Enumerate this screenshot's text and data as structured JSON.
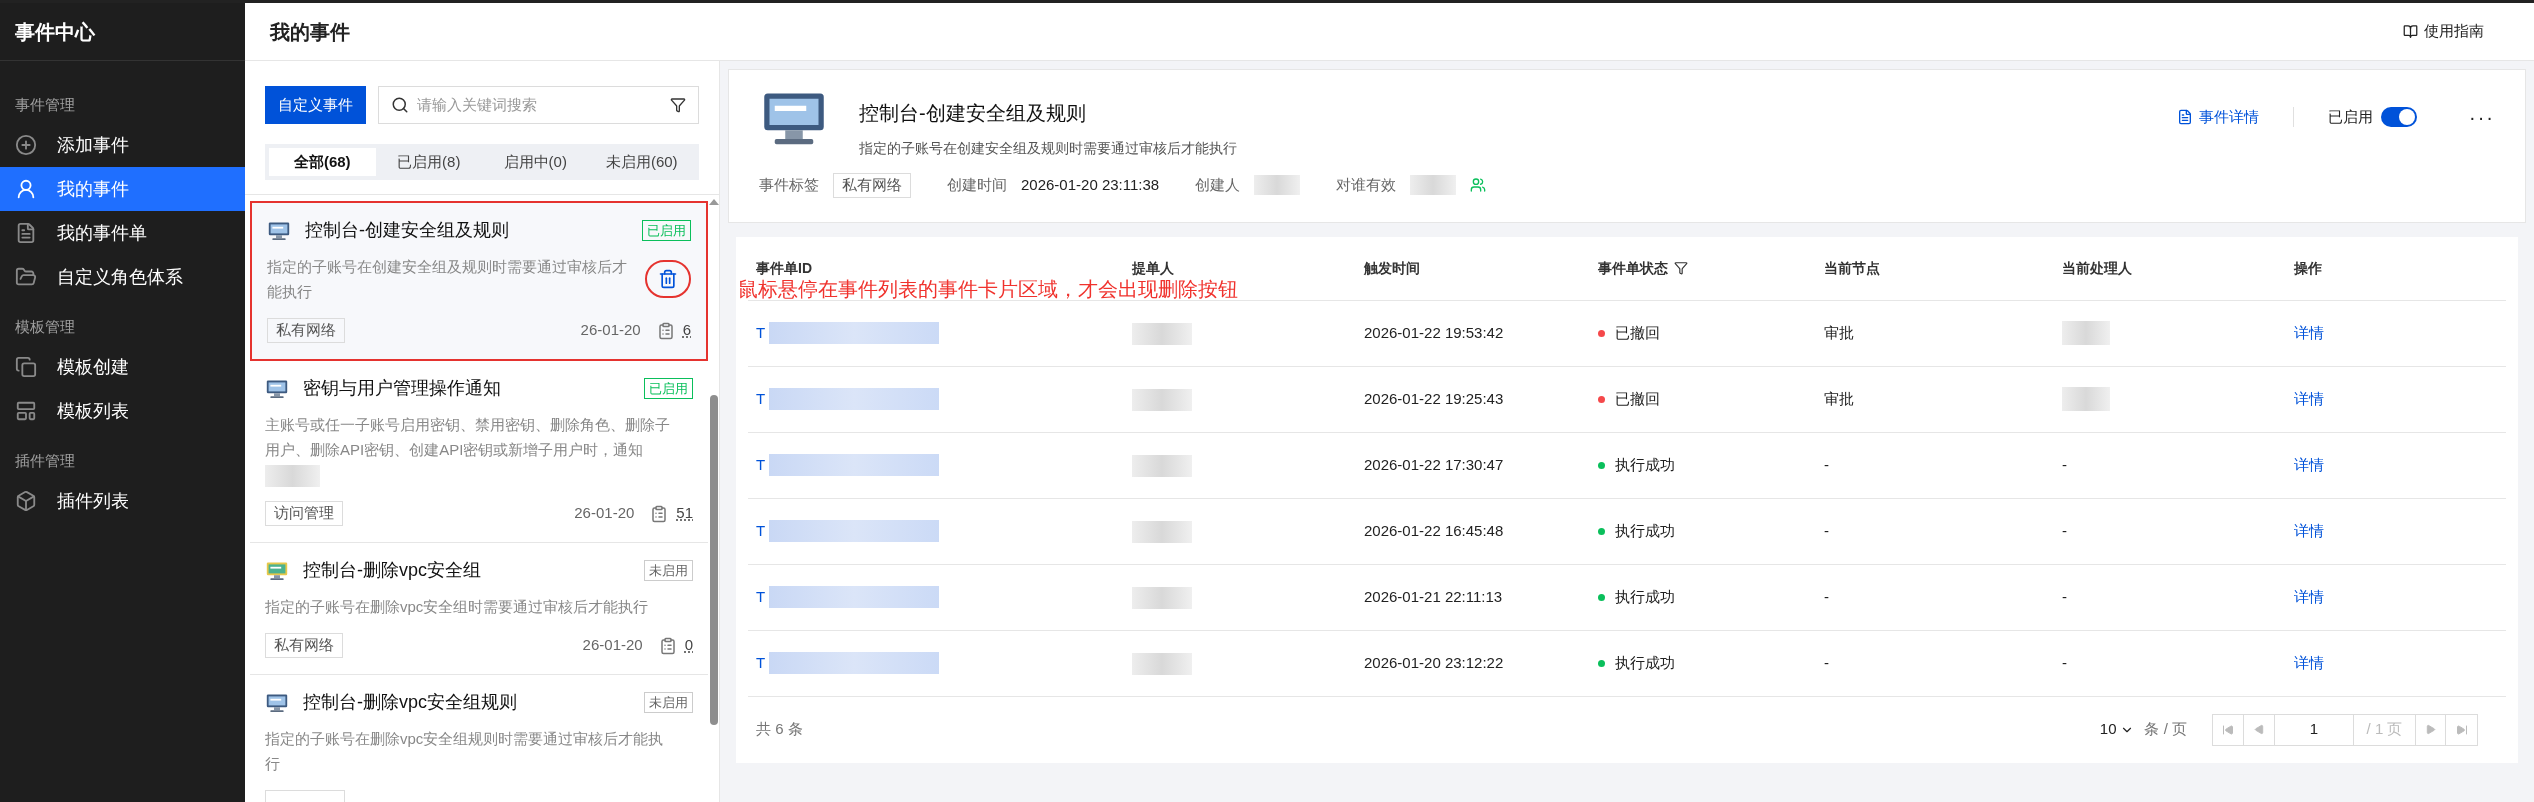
{
  "sidebar": {
    "title": "事件中心",
    "sections": [
      {
        "heading": "事件管理",
        "items": [
          {
            "label": "添加事件",
            "selected": false
          },
          {
            "label": "我的事件",
            "selected": true
          },
          {
            "label": "我的事件单",
            "selected": false
          },
          {
            "label": "自定义角色体系",
            "selected": false
          }
        ]
      },
      {
        "heading": "模板管理",
        "items": [
          {
            "label": "模板创建",
            "selected": false
          },
          {
            "label": "模板列表",
            "selected": false
          }
        ]
      },
      {
        "heading": "插件管理",
        "items": [
          {
            "label": "插件列表",
            "selected": false
          }
        ]
      }
    ]
  },
  "header": {
    "title": "我的事件",
    "guide_link": "使用指南"
  },
  "event_list": {
    "create_button": "自定义事件",
    "search": {
      "placeholder": "请输入关键词搜索"
    },
    "tabs": [
      {
        "label": "全部(68)",
        "selected": true
      },
      {
        "label": "已启用(8)",
        "selected": false
      },
      {
        "label": "启用中(0)",
        "selected": false
      },
      {
        "label": "未启用(60)",
        "selected": false
      }
    ],
    "cards": [
      {
        "title": "控制台-创建安全组及规则",
        "status": "已启用",
        "enabled": true,
        "description": "指定的子账号在创建安全组及规则时需要通过审核后才能执行",
        "description_redacted": false,
        "tag": "私有网络",
        "date": "26-01-20",
        "count": "6",
        "hovered": true,
        "annotated": true
      },
      {
        "title": "密钥与用户管理操作通知",
        "status": "已启用",
        "enabled": true,
        "description": "主账号或任一子账号启用密钥、禁用密钥、删除角色、删除子用户、删除API密钥、创建API密钥或新增子用户时，通知",
        "description_redacted": true,
        "tag": "访问管理",
        "date": "26-01-20",
        "count": "51",
        "hovered": false,
        "annotated": false
      },
      {
        "title": "控制台-删除vpc安全组",
        "status": "未启用",
        "enabled": false,
        "description": "指定的子账号在删除vpc安全组时需要通过审核后才能执行",
        "description_redacted": false,
        "tag": "私有网络",
        "date": "26-01-20",
        "count": "0",
        "hovered": false,
        "annotated": false
      },
      {
        "title": "控制台-删除vpc安全组规则",
        "status": "未启用",
        "enabled": false,
        "description": "指定的子账号在删除vpc安全组规则时需要通过审核后才能执行",
        "description_redacted": false,
        "hovered": false,
        "annotated": false
      }
    ]
  },
  "detail": {
    "title": "控制台-创建安全组及规则",
    "description": "指定的子账号在创建安全组及规则时需要通过审核后才能执行",
    "details_link": "事件详情",
    "switch": {
      "label": "已启用",
      "on": true
    },
    "more": "···",
    "meta": [
      {
        "label": "事件标签",
        "kind": "tag",
        "value": "私有网络"
      },
      {
        "label": "创建时间",
        "kind": "text",
        "value": "2026-01-20 23:11:38"
      },
      {
        "label": "创建人",
        "kind": "redacted"
      },
      {
        "label": "对谁有效",
        "kind": "people"
      }
    ]
  },
  "table": {
    "columns": [
      {
        "label": "事件单ID",
        "filter": false
      },
      {
        "label": "提单人",
        "filter": false
      },
      {
        "label": "触发时间",
        "filter": false
      },
      {
        "label": "事件单状态",
        "filter": true
      },
      {
        "label": "当前节点",
        "filter": false
      },
      {
        "label": "当前处理人",
        "filter": false
      },
      {
        "label": "操作",
        "filter": false
      }
    ],
    "rows": [
      {
        "id": "T",
        "time": "2026-01-22 19:53:42",
        "status": "已撤回",
        "color": "#f5484a",
        "node": "审批",
        "handler": {
          "kind": "redacted"
        },
        "action": "详情"
      },
      {
        "id": "T",
        "time": "2026-01-22 19:25:43",
        "status": "已撤回",
        "color": "#f5484a",
        "node": "审批",
        "handler": {
          "kind": "redacted"
        },
        "action": "详情"
      },
      {
        "id": "T",
        "time": "2026-01-22 17:30:47",
        "status": "执行成功",
        "color": "#0abf5b",
        "node": "-",
        "handler": {
          "kind": "text",
          "text": "-"
        },
        "action": "详情"
      },
      {
        "id": "T",
        "time": "2026-01-22 16:45:48",
        "status": "执行成功",
        "color": "#0abf5b",
        "node": "-",
        "handler": {
          "kind": "text",
          "text": "-"
        },
        "action": "详情"
      },
      {
        "id": "T",
        "time": "2026-01-21 22:11:13",
        "status": "执行成功",
        "color": "#0abf5b",
        "node": "-",
        "handler": {
          "kind": "text",
          "text": "-"
        },
        "action": "详情"
      },
      {
        "id": "T",
        "time": "2026-01-20 23:12:22",
        "status": "执行成功",
        "color": "#0abf5b",
        "node": "-",
        "handler": {
          "kind": "text",
          "text": "-"
        },
        "action": "详情"
      }
    ],
    "total": "共 6 条",
    "page_size": "10",
    "page_size_unit": "条 / 页",
    "page": "1",
    "page_total": "/ 1 页"
  },
  "annotation": {
    "text": "鼠标悬停在事件列表的事件卡片区域，才会出现删除按钮"
  }
}
